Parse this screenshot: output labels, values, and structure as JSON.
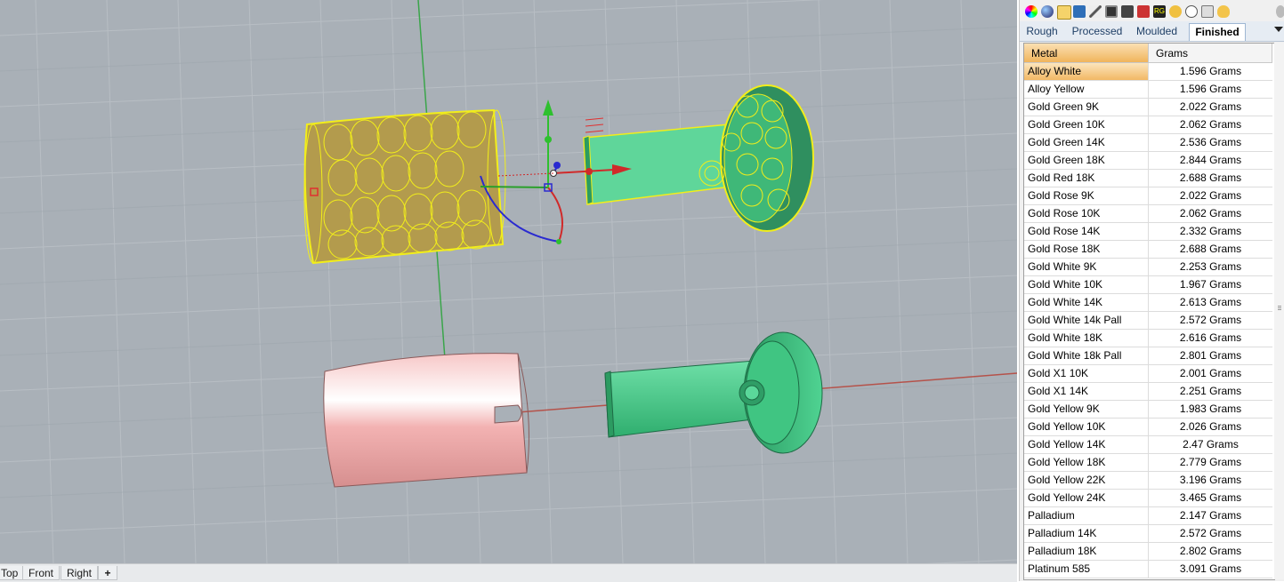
{
  "viewport_tabs": [
    "Top",
    "Front",
    "Right"
  ],
  "add_view_icon": "plus-icon",
  "toolbar_icons": [
    "color-wheel-icon",
    "sphere-icon",
    "folder-icon",
    "image-icon",
    "pencil-icon",
    "monitor-icon",
    "book-icon",
    "rg-icon",
    "bulb-icon",
    "clock-icon",
    "trash-icon",
    "egg-icon",
    "settings-icon"
  ],
  "material_tabs": [
    {
      "label": "Rough"
    },
    {
      "label": "Processed"
    },
    {
      "label": "Moulded"
    },
    {
      "label": "Finished",
      "active": true
    }
  ],
  "table": {
    "headers": {
      "metal": "Metal",
      "grams": "Grams"
    },
    "rows": [
      {
        "metal": "Alloy White",
        "grams": "1.596 Grams",
        "selected": true
      },
      {
        "metal": "Alloy Yellow",
        "grams": "1.596 Grams"
      },
      {
        "metal": "Gold Green 9K",
        "grams": "2.022 Grams"
      },
      {
        "metal": "Gold Green 10K",
        "grams": "2.062 Grams"
      },
      {
        "metal": "Gold Green 14K",
        "grams": "2.536 Grams"
      },
      {
        "metal": "Gold Green 18K",
        "grams": "2.844 Grams"
      },
      {
        "metal": "Gold Red 18K",
        "grams": "2.688 Grams"
      },
      {
        "metal": "Gold Rose 9K",
        "grams": "2.022 Grams"
      },
      {
        "metal": "Gold Rose 10K",
        "grams": "2.062 Grams"
      },
      {
        "metal": "Gold Rose 14K",
        "grams": "2.332 Grams"
      },
      {
        "metal": "Gold Rose 18K",
        "grams": "2.688 Grams"
      },
      {
        "metal": "Gold White 9K",
        "grams": "2.253 Grams"
      },
      {
        "metal": "Gold White 10K",
        "grams": "1.967 Grams"
      },
      {
        "metal": "Gold White 14K",
        "grams": "2.613 Grams"
      },
      {
        "metal": "Gold White 14k Pall",
        "grams": "2.572 Grams"
      },
      {
        "metal": "Gold White 18K",
        "grams": "2.616 Grams"
      },
      {
        "metal": "Gold White 18k Pall",
        "grams": "2.801 Grams"
      },
      {
        "metal": "Gold X1 10K",
        "grams": "2.001 Grams"
      },
      {
        "metal": "Gold X1 14K",
        "grams": "2.251 Grams"
      },
      {
        "metal": "Gold Yellow 9K",
        "grams": "1.983 Grams"
      },
      {
        "metal": "Gold Yellow 10K",
        "grams": "2.026 Grams"
      },
      {
        "metal": "Gold Yellow 14K",
        "grams": "2.47 Grams"
      },
      {
        "metal": "Gold Yellow 18K",
        "grams": "2.779 Grams"
      },
      {
        "metal": "Gold Yellow 22K",
        "grams": "3.196 Grams"
      },
      {
        "metal": "Gold Yellow 24K",
        "grams": "3.465 Grams"
      },
      {
        "metal": "Palladium",
        "grams": "2.147 Grams"
      },
      {
        "metal": "Palladium 14K",
        "grams": "2.572 Grams"
      },
      {
        "metal": "Palladium 18K",
        "grams": "2.802 Grams"
      },
      {
        "metal": "Platinum 585",
        "grams": "3.091 Grams"
      }
    ]
  },
  "colors": {
    "viewport_bg": "#a9b0b7",
    "grid": "#b6bcc2",
    "wire": "#f2ee1a",
    "green_part": "#3ec785",
    "pink_part": "#f4b8b8",
    "selected_header": "#f0b45c"
  }
}
